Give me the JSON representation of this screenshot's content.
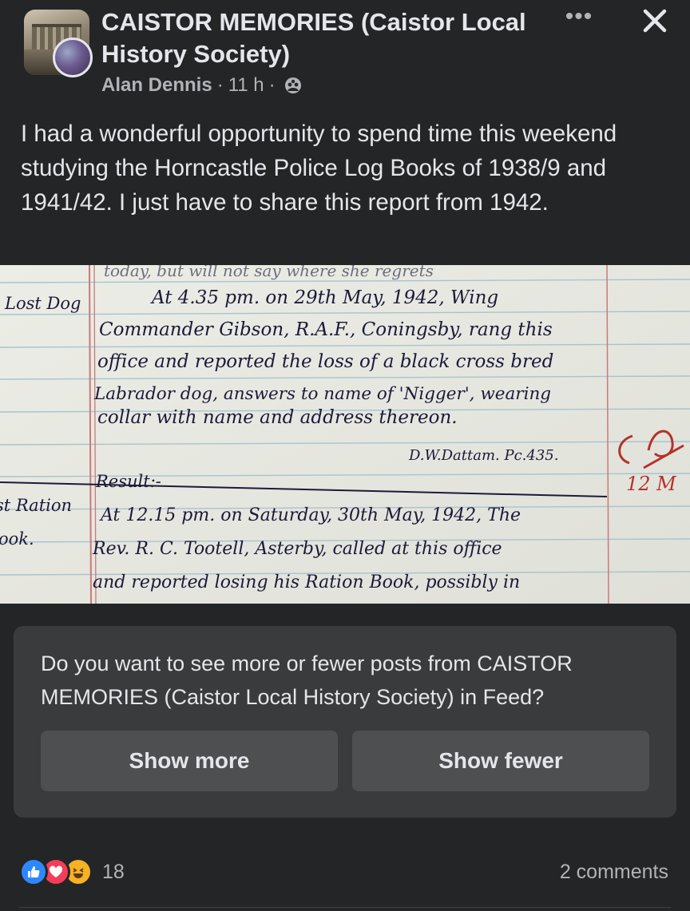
{
  "post": {
    "group_name": "CAISTOR MEMORIES (Caistor Local History Society)",
    "author": "Alan Dennis",
    "time": "11 h",
    "text": "I had a wonderful opportunity to spend time this weekend studying the Horncastle Police Log Books of 1938/9 and 1941/42. I just have to share this report from 1942."
  },
  "photo": {
    "margin_lines": [
      "Lost Dog",
      "st Ration",
      "ook."
    ],
    "body_lines": [
      "today, but will not say where she regrets",
      "At 4.35 pm. on 29th May, 1942, Wing",
      "Commander Gibson, R.A.F., Coningsby, rang this",
      "office and reported the loss of a black cross bred",
      "Labrador dog, answers to name of 'Nigger', wearing",
      "collar with name and address thereon.",
      "D.W.Dattam. Pc.435.",
      "Result:-",
      "At 12.15 pm. on Saturday, 30th May, 1942, The",
      "Rev. R. C. Tootell, Asterby, called at this office",
      "and reported losing his Ration Book, possibly in"
    ],
    "red_marks": [
      "12 M"
    ]
  },
  "feedback": {
    "question": "Do you want to see more or fewer posts from CAISTOR MEMORIES (Caistor Local History Society) in Feed?",
    "show_more": "Show more",
    "show_fewer": "Show fewer"
  },
  "footer": {
    "reaction_count": "18",
    "comments": "2 comments",
    "reactions": [
      "like-icon",
      "love-icon",
      "haha-icon"
    ]
  },
  "colors": {
    "background": "#242526",
    "card": "#3a3b3c",
    "button": "#4e4f50",
    "text_primary": "#e4e6eb",
    "text_secondary": "#b0b3b8",
    "ink": "#1c1a3a",
    "red_ink": "#b5322a"
  }
}
